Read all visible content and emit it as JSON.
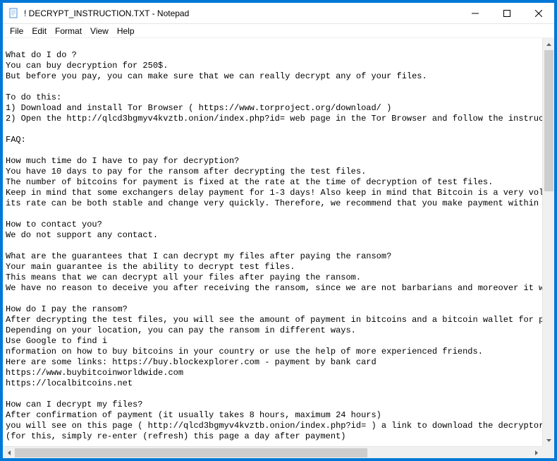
{
  "window": {
    "title": "! DECRYPT_INSTRUCTION.TXT - Notepad"
  },
  "menu": {
    "file": "File",
    "edit": "Edit",
    "format": "Format",
    "view": "View",
    "help": "Help"
  },
  "content": "\nWhat do I do ?\nYou can buy decryption for 250$.\nBut before you pay, you can make sure that we can really decrypt any of your files.\n\nTo do this:\n1) Download and install Tor Browser ( https://www.torproject.org/download/ )\n2) Open the http://qlcd3bgmyv4kvztb.onion/index.php?id= web page in the Tor Browser and follow the instruc\n\nFAQ:\n\nHow much time do I have to pay for decryption?\nYou have 10 days to pay for the ransom after decrypting the test files.\nThe number of bitcoins for payment is fixed at the rate at the time of decryption of test files.\nKeep in mind that some exchangers delay payment for 1-3 days! Also keep in mind that Bitcoin is a very vol\nits rate can be both stable and change very quickly. Therefore, we recommend that you make payment within \n\nHow to contact you?\nWe do not support any contact.\n\nWhat are the guarantees that I can decrypt my files after paying the ransom?\nYour main guarantee is the ability to decrypt test files.\nThis means that we can decrypt all your files after paying the ransom.\nWe have no reason to deceive you after receiving the ransom, since we are not barbarians and moreover it w\n\nHow do I pay the ransom?\nAfter decrypting the test files, you will see the amount of payment in bitcoins and a bitcoin wallet for p\nDepending on your location, you can pay the ransom in different ways.\nUse Google to find i\nnformation on how to buy bitcoins in your country or use the help of more experienced friends.\nHere are some links: https://buy.blockexplorer.com - payment by bank card\nhttps://www.buybitcoinworldwide.com\nhttps://localbitcoins.net\n\nHow can I decrypt my files?\nAfter confirmation of payment (it usually takes 8 hours, maximum 24 hours)\nyou will see on this page ( http://qlcd3bgmyv4kvztb.onion/index.php?id= ) a link to download the decryptor\n(for this, simply re-enter (refresh) this page a day after payment)"
}
